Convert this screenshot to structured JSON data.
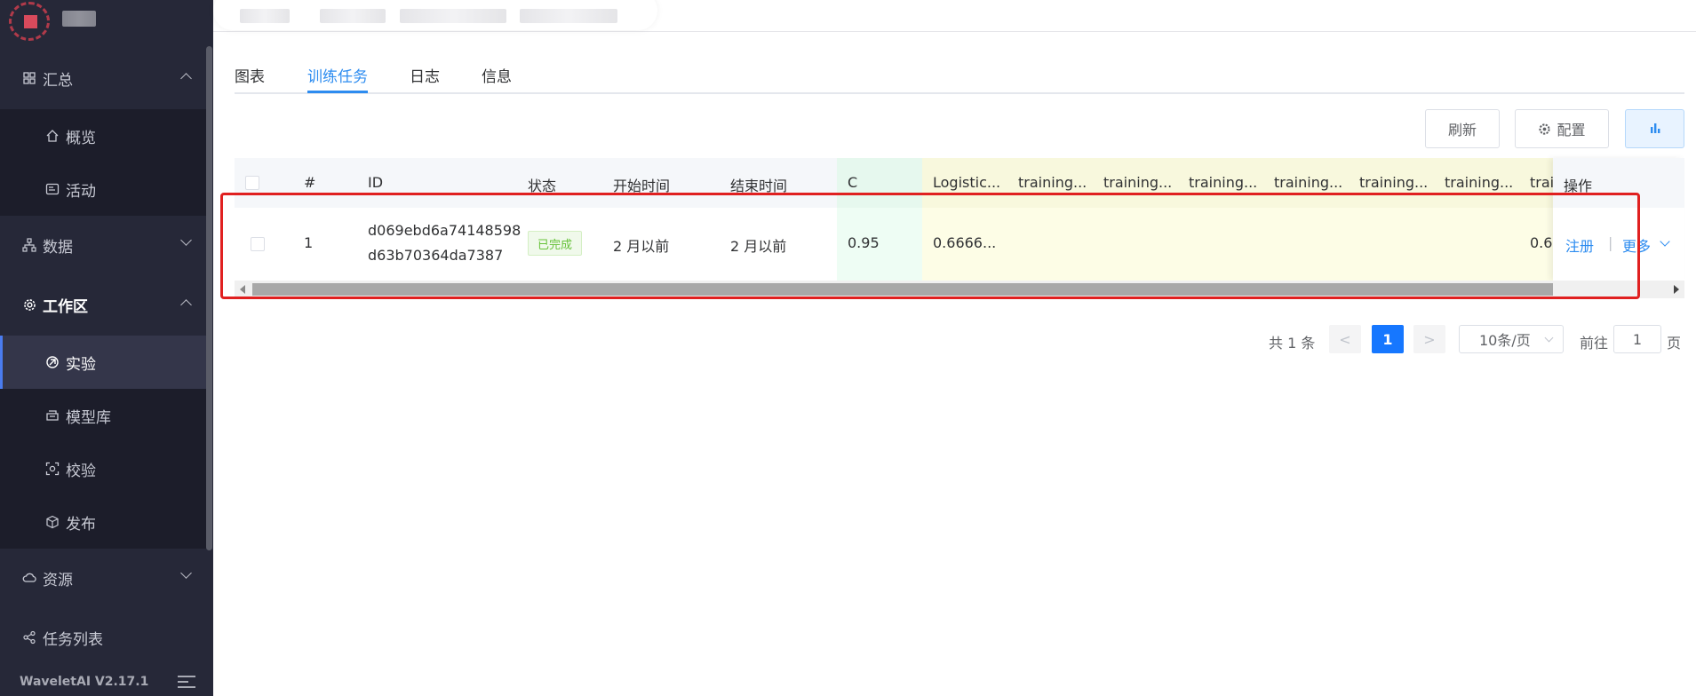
{
  "sidebar": {
    "menu": {
      "summary": {
        "label": "汇总",
        "icon": "grid-icon"
      },
      "overview": {
        "label": "概览",
        "icon": "home-icon"
      },
      "activity": {
        "label": "活动",
        "icon": "activity-icon"
      },
      "data": {
        "label": "数据",
        "icon": "sitemap-icon"
      },
      "workspace": {
        "label": "工作区",
        "icon": "gear-icon"
      },
      "experiment": {
        "label": "实验",
        "icon": "experiment-icon"
      },
      "model_repo": {
        "label": "模型库",
        "icon": "model-repo-icon"
      },
      "validate": {
        "label": "校验",
        "icon": "scan-icon"
      },
      "publish": {
        "label": "发布",
        "icon": "box-icon"
      },
      "resource": {
        "label": "资源",
        "icon": "cloud-icon"
      },
      "task_list": {
        "label": "任务列表",
        "icon": "share-icon"
      }
    },
    "version": "WaveletAI V2.17.1"
  },
  "tabs": [
    "图表",
    "训练任务",
    "日志",
    "信息"
  ],
  "active_tab": "训练任务",
  "toolbar": {
    "refresh": "刷新",
    "config": "配置"
  },
  "table": {
    "columns": [
      "#",
      "ID",
      "状态",
      "开始时间",
      "结束时间",
      "C",
      "Logistic...",
      "training...",
      "training...",
      "training...",
      "training...",
      "training...",
      "training...",
      "trai",
      "操作"
    ],
    "row": {
      "index": "1",
      "id_line1": "d069ebd6a74148598",
      "id_line2": "d63b70364da7387",
      "status": "已完成",
      "start": "2 月以前",
      "end": "2 月以前",
      "c": "0.95",
      "logistic": "0.6666...",
      "trai": "0.6",
      "op_register": "注册",
      "op_sep": "|",
      "op_more": "更多"
    }
  },
  "pagination": {
    "total": "共 1 条",
    "prev": "<",
    "current": "1",
    "next": ">",
    "page_size": "10条/页",
    "goto_label": "前往",
    "goto_value": "1",
    "page_suffix": "页"
  },
  "colors": {
    "accent": "#2d8cf0",
    "sidebar_bg": "#262838",
    "highlight": "#e02020",
    "status_green": "#67c23a"
  }
}
